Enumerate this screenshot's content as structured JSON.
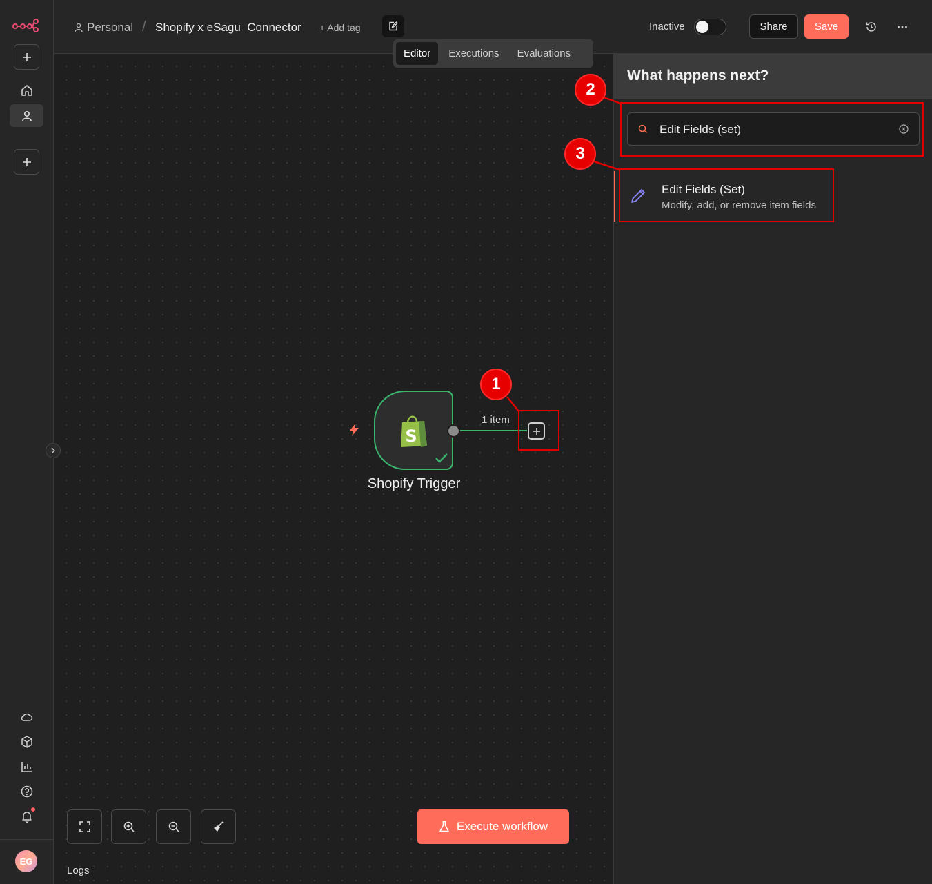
{
  "header": {
    "breadcrumb_project": "Personal",
    "breadcrumb_separator": "/",
    "workflow_title": "Shopify x eSagu  Connector",
    "add_tag": "+ Add tag",
    "status_label": "Inactive",
    "active": false,
    "share_label": "Share",
    "save_label": "Save",
    "tabs": [
      {
        "label": "Editor",
        "active": true
      },
      {
        "label": "Executions",
        "active": false
      },
      {
        "label": "Evaluations",
        "active": false
      }
    ]
  },
  "sidebar": {
    "avatar_initials": "EG"
  },
  "canvas": {
    "node_label": "Shopify Trigger",
    "connection_label": "1 item",
    "execute_label": "Execute workflow",
    "logs_label": "Logs"
  },
  "panel": {
    "title": "What happens next?",
    "search_value": "Edit Fields (set)",
    "result_title": "Edit Fields (Set)",
    "result_description": "Modify, add, or remove item fields"
  },
  "annotations": [
    "1",
    "2",
    "3"
  ],
  "colors": {
    "accent": "#ff6d5a",
    "success": "#3bb56e",
    "annotation": "#e00000"
  }
}
